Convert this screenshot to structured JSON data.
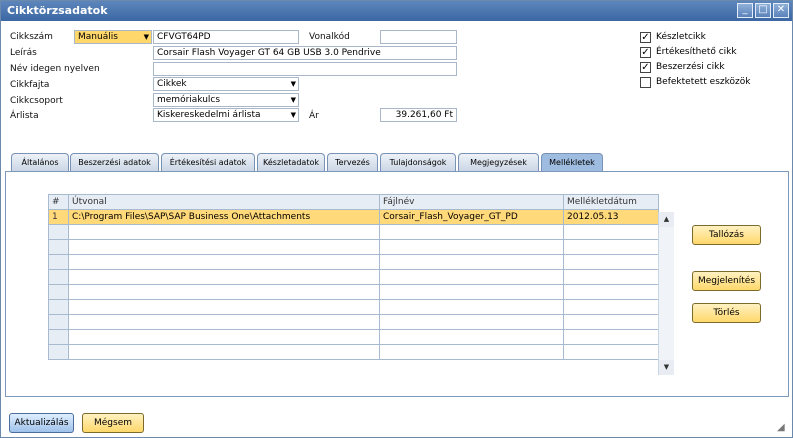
{
  "window": {
    "title": "Cikktörzsadatok",
    "buttons": [
      "_",
      "□",
      "✕"
    ]
  },
  "form": {
    "item_number_label": "Cikkszám",
    "item_number_mode": "Manuális",
    "item_number": "CFVGT64PD",
    "barcode_label": "Vonalkód",
    "barcode": "",
    "description_label": "Leírás",
    "description": "Corsair Flash Voyager GT 64 GB USB 3.0 Pendrive",
    "foreign_name_label": "Név idegen nyelven",
    "foreign_name": "",
    "item_type_label": "Cikkfajta",
    "item_type": "Cikkek",
    "item_group_label": "Cikkcsoport",
    "item_group": "memóriakulcs",
    "price_list_label": "Árlista",
    "price_list": "Kiskereskedelmi árlista",
    "price_label": "Ár",
    "price": "39.261,60 Ft"
  },
  "checkboxes": [
    {
      "label": "Készletcikk",
      "checked": true
    },
    {
      "label": "Értékesíthető cikk",
      "checked": true
    },
    {
      "label": "Beszerzési cikk",
      "checked": true
    },
    {
      "label": "Befektetett eszközök",
      "checked": false
    }
  ],
  "tabs": [
    {
      "label": "Általános",
      "active": false
    },
    {
      "label": "Beszerzési adatok",
      "active": false
    },
    {
      "label": "Értékesítési adatok",
      "active": false
    },
    {
      "label": "Készletadatok",
      "active": false
    },
    {
      "label": "Tervezés",
      "active": false
    },
    {
      "label": "Tulajdonságok",
      "active": false
    },
    {
      "label": "Megjegyzések",
      "active": false
    },
    {
      "label": "Mellékletek",
      "active": true
    }
  ],
  "table": {
    "headers": [
      "#",
      "Útvonal",
      "Fájlnév",
      "Mellékletdátum"
    ],
    "rows": [
      [
        "1",
        "C:\\Program Files\\SAP\\SAP Business One\\Attachments",
        "Corsair_Flash_Voyager_GT_PD",
        "2012.05.13"
      ]
    ],
    "empty_rows": 9
  },
  "actions": {
    "browse": "Tallózás",
    "show": "Megjelenítés",
    "delete": "Törlés",
    "update": "Aktualizálás",
    "cancel": "Mégsem"
  },
  "icons": {
    "scroll_up": "▲",
    "scroll_down": "▼",
    "dropdown_arrow": "▼",
    "resize_grip": "◢"
  },
  "colors": {
    "title_bar": "#4f79b2",
    "selected_row": "#ffd97a",
    "button_yellow": "#ffd86b",
    "active_tab": "#9ebcdf"
  }
}
